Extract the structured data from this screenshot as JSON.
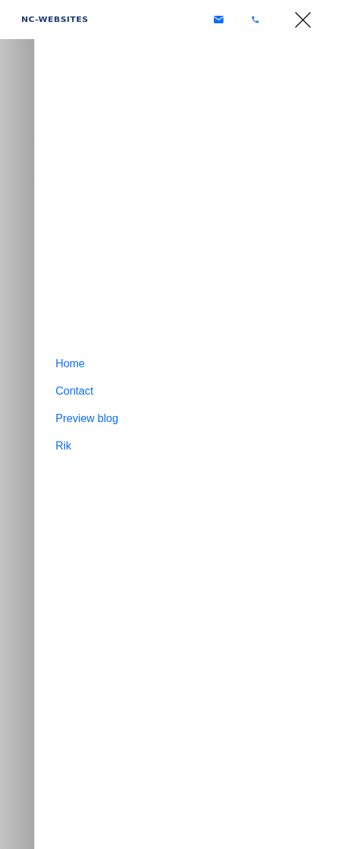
{
  "header": {
    "logo": "NC-WEBSITES"
  },
  "menu": {
    "items": [
      {
        "label": "Home"
      },
      {
        "label": "Contact"
      },
      {
        "label": "Preview blog"
      },
      {
        "label": "Rik"
      }
    ]
  }
}
